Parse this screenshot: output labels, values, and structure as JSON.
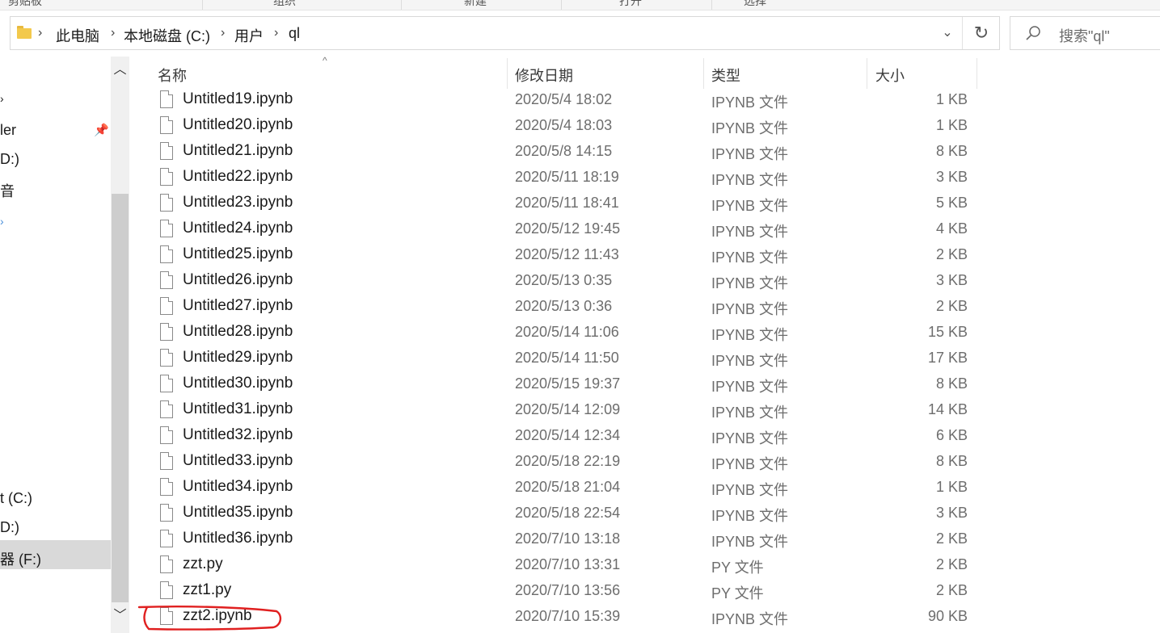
{
  "ribbon": {
    "groups": [
      "剪贴板",
      "组织",
      "新建",
      "打开",
      "选择"
    ]
  },
  "address_bar": {
    "breadcrumbs": [
      "此电脑",
      "本地磁盘 (C:)",
      "用户",
      "ql"
    ]
  },
  "search": {
    "placeholder": "搜索\"ql\""
  },
  "nav_pane": {
    "items": [
      "ler",
      "D:)",
      "音",
      "t (C:)",
      "D:)",
      "器 (F:)"
    ],
    "selected_item": "t (C:)"
  },
  "columns": {
    "name": "名称",
    "date": "修改日期",
    "type": "类型",
    "size": "大小"
  },
  "files": [
    {
      "name": "Untitled19.ipynb",
      "date": "2020/5/4 18:02",
      "type": "IPYNB 文件",
      "size": "1 KB"
    },
    {
      "name": "Untitled20.ipynb",
      "date": "2020/5/4 18:03",
      "type": "IPYNB 文件",
      "size": "1 KB"
    },
    {
      "name": "Untitled21.ipynb",
      "date": "2020/5/8 14:15",
      "type": "IPYNB 文件",
      "size": "8 KB"
    },
    {
      "name": "Untitled22.ipynb",
      "date": "2020/5/11 18:19",
      "type": "IPYNB 文件",
      "size": "3 KB"
    },
    {
      "name": "Untitled23.ipynb",
      "date": "2020/5/11 18:41",
      "type": "IPYNB 文件",
      "size": "5 KB"
    },
    {
      "name": "Untitled24.ipynb",
      "date": "2020/5/12 19:45",
      "type": "IPYNB 文件",
      "size": "4 KB"
    },
    {
      "name": "Untitled25.ipynb",
      "date": "2020/5/12 11:43",
      "type": "IPYNB 文件",
      "size": "2 KB"
    },
    {
      "name": "Untitled26.ipynb",
      "date": "2020/5/13 0:35",
      "type": "IPYNB 文件",
      "size": "3 KB"
    },
    {
      "name": "Untitled27.ipynb",
      "date": "2020/5/13 0:36",
      "type": "IPYNB 文件",
      "size": "2 KB"
    },
    {
      "name": "Untitled28.ipynb",
      "date": "2020/5/14 11:06",
      "type": "IPYNB 文件",
      "size": "15 KB"
    },
    {
      "name": "Untitled29.ipynb",
      "date": "2020/5/14 11:50",
      "type": "IPYNB 文件",
      "size": "17 KB"
    },
    {
      "name": "Untitled30.ipynb",
      "date": "2020/5/15 19:37",
      "type": "IPYNB 文件",
      "size": "8 KB"
    },
    {
      "name": "Untitled31.ipynb",
      "date": "2020/5/14 12:09",
      "type": "IPYNB 文件",
      "size": "14 KB"
    },
    {
      "name": "Untitled32.ipynb",
      "date": "2020/5/14 12:34",
      "type": "IPYNB 文件",
      "size": "6 KB"
    },
    {
      "name": "Untitled33.ipynb",
      "date": "2020/5/18 22:19",
      "type": "IPYNB 文件",
      "size": "8 KB"
    },
    {
      "name": "Untitled34.ipynb",
      "date": "2020/5/18 21:04",
      "type": "IPYNB 文件",
      "size": "1 KB"
    },
    {
      "name": "Untitled35.ipynb",
      "date": "2020/5/18 22:54",
      "type": "IPYNB 文件",
      "size": "3 KB"
    },
    {
      "name": "Untitled36.ipynb",
      "date": "2020/7/10 13:18",
      "type": "IPYNB 文件",
      "size": "2 KB"
    },
    {
      "name": "zzt.py",
      "date": "2020/7/10 13:31",
      "type": "PY 文件",
      "size": "2 KB"
    },
    {
      "name": "zzt1.py",
      "date": "2020/7/10 13:56",
      "type": "PY 文件",
      "size": "2 KB"
    },
    {
      "name": "zzt2.ipynb",
      "date": "2020/7/10 15:39",
      "type": "IPYNB 文件",
      "size": "90 KB"
    }
  ],
  "annotation": {
    "color": "#e02020",
    "target_file": "zzt2.ipynb"
  },
  "icons": {
    "folder": "folder-icon",
    "chevron": "chevron-right-icon",
    "dropdown": "chevron-down-icon",
    "refresh": "refresh-icon",
    "search": "search-icon",
    "pin": "pin-icon",
    "scroll_up": "scroll-up-icon",
    "scroll_down": "scroll-down-icon",
    "file": "file-icon"
  }
}
